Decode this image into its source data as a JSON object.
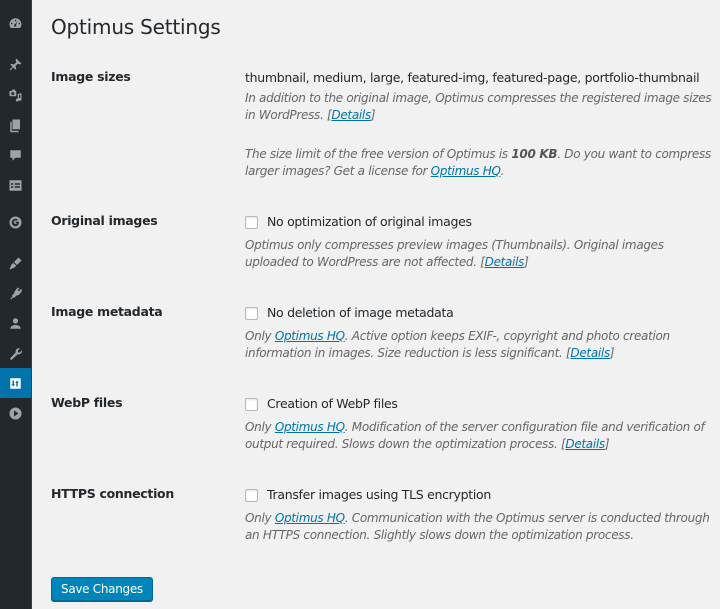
{
  "sidebar": {
    "items": [
      {
        "icon": "dashboard-icon"
      },
      {
        "icon": "pin-icon"
      },
      {
        "icon": "media-icon"
      },
      {
        "icon": "pages-icon"
      },
      {
        "icon": "comments-icon"
      },
      {
        "icon": "forms-icon"
      },
      {
        "icon": "g-plugin-icon"
      },
      {
        "icon": "appearance-brush-icon"
      },
      {
        "icon": "plugins-icon"
      },
      {
        "icon": "users-icon"
      },
      {
        "icon": "tools-wrench-icon"
      },
      {
        "icon": "settings-sliders-icon",
        "active": true
      },
      {
        "icon": "play-icon"
      }
    ],
    "active_color": "#0073aa",
    "bg_color": "#23282d"
  },
  "page": {
    "title": "Optimus Settings"
  },
  "rows": {
    "image_sizes": {
      "label": "Image sizes",
      "value": "thumbnail, medium, large, featured-img, featured-page, portfolio-thumbnail",
      "desc1_pre": "In addition to the original image, Optimus compresses the registered image sizes in WordPress. [",
      "desc1_link": "Details",
      "desc1_post": "]",
      "desc2_pre": "The size limit of the free version of Optimus is ",
      "desc2_bold": "100 KB",
      "desc2_mid": ". Do you want to compress larger images? Get a license for ",
      "desc2_link": "Optimus HQ",
      "desc2_post": "."
    },
    "original_images": {
      "label": "Original images",
      "checkbox_label": "No optimization of original images",
      "checked": false,
      "desc_pre": "Optimus only compresses preview images (Thumbnails). Original images uploaded to WordPress are not affected. [",
      "desc_link": "Details",
      "desc_post": "]"
    },
    "image_metadata": {
      "label": "Image metadata",
      "checkbox_label": "No deletion of image metadata",
      "checked": false,
      "desc_pre": "Only ",
      "desc_link1": "Optimus HQ",
      "desc_mid": ". Active option keeps EXIF-, copyright and photo creation information in images. Size reduction is less significant. [",
      "desc_link2": "Details",
      "desc_post": "]"
    },
    "webp_files": {
      "label": "WebP files",
      "checkbox_label": "Creation of WebP files",
      "checked": false,
      "desc_pre": "Only ",
      "desc_link1": "Optimus HQ",
      "desc_mid": ". Modification of the server configuration file and verification of output required. Slows down the optimization process. [",
      "desc_link2": "Details",
      "desc_post": "]"
    },
    "https_connection": {
      "label": "HTTPS connection",
      "checkbox_label": "Transfer images using TLS encryption",
      "checked": false,
      "desc_pre": "Only ",
      "desc_link1": "Optimus HQ",
      "desc_post": ". Communication with the Optimus server is conducted through an HTTPS connection. Slightly slows down the optimization process."
    }
  },
  "footer": {
    "save_label": "Save Changes",
    "save_color": "#0085ba"
  }
}
